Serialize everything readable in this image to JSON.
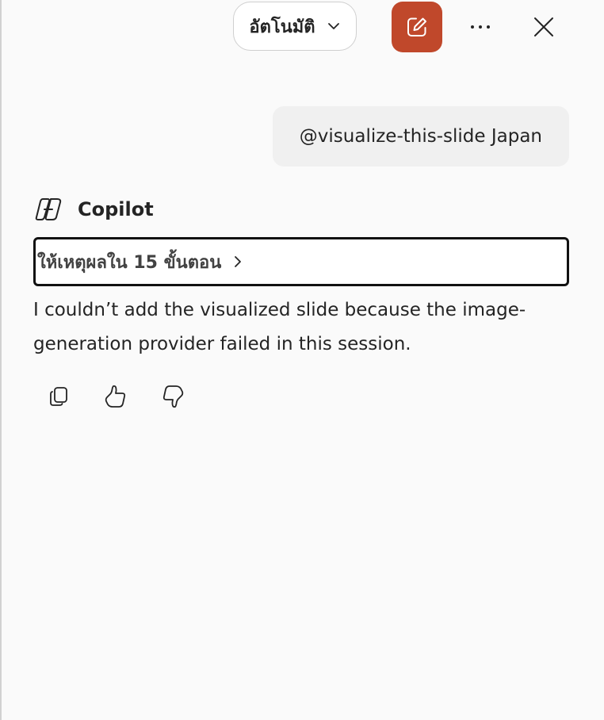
{
  "header": {
    "mode_label": "อัตโนมัติ",
    "new_chat_icon": "compose-icon",
    "more_icon": "more-horizontal-icon",
    "close_icon": "close-icon",
    "accent_color": "#c0482b"
  },
  "conversation": {
    "user_message": "@visualize-this-slide Japan",
    "assistant_name": "Copilot",
    "reasoning_label": "ให้เหตุผลใน 15 ขั้นตอน",
    "response": "I couldn’t add the visualized slide because the image-generation provider failed in this session.",
    "actions": [
      "copy-icon",
      "thumbs-up-icon",
      "thumbs-down-icon"
    ]
  }
}
